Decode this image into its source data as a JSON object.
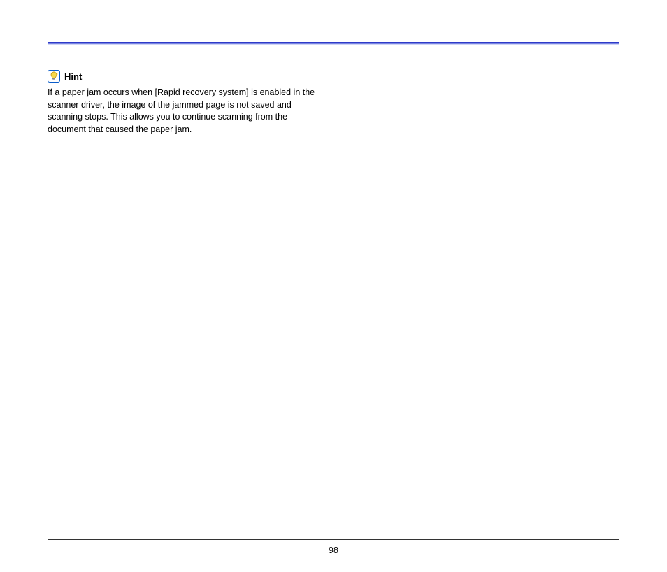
{
  "hint": {
    "label": "Hint",
    "body": "If a paper jam occurs when [Rapid recovery system] is enabled in the scanner driver, the image of the jammed page is not saved and scanning stops. This allows you to continue scanning from the document that caused the paper jam."
  },
  "footer": {
    "page_number": "98"
  }
}
